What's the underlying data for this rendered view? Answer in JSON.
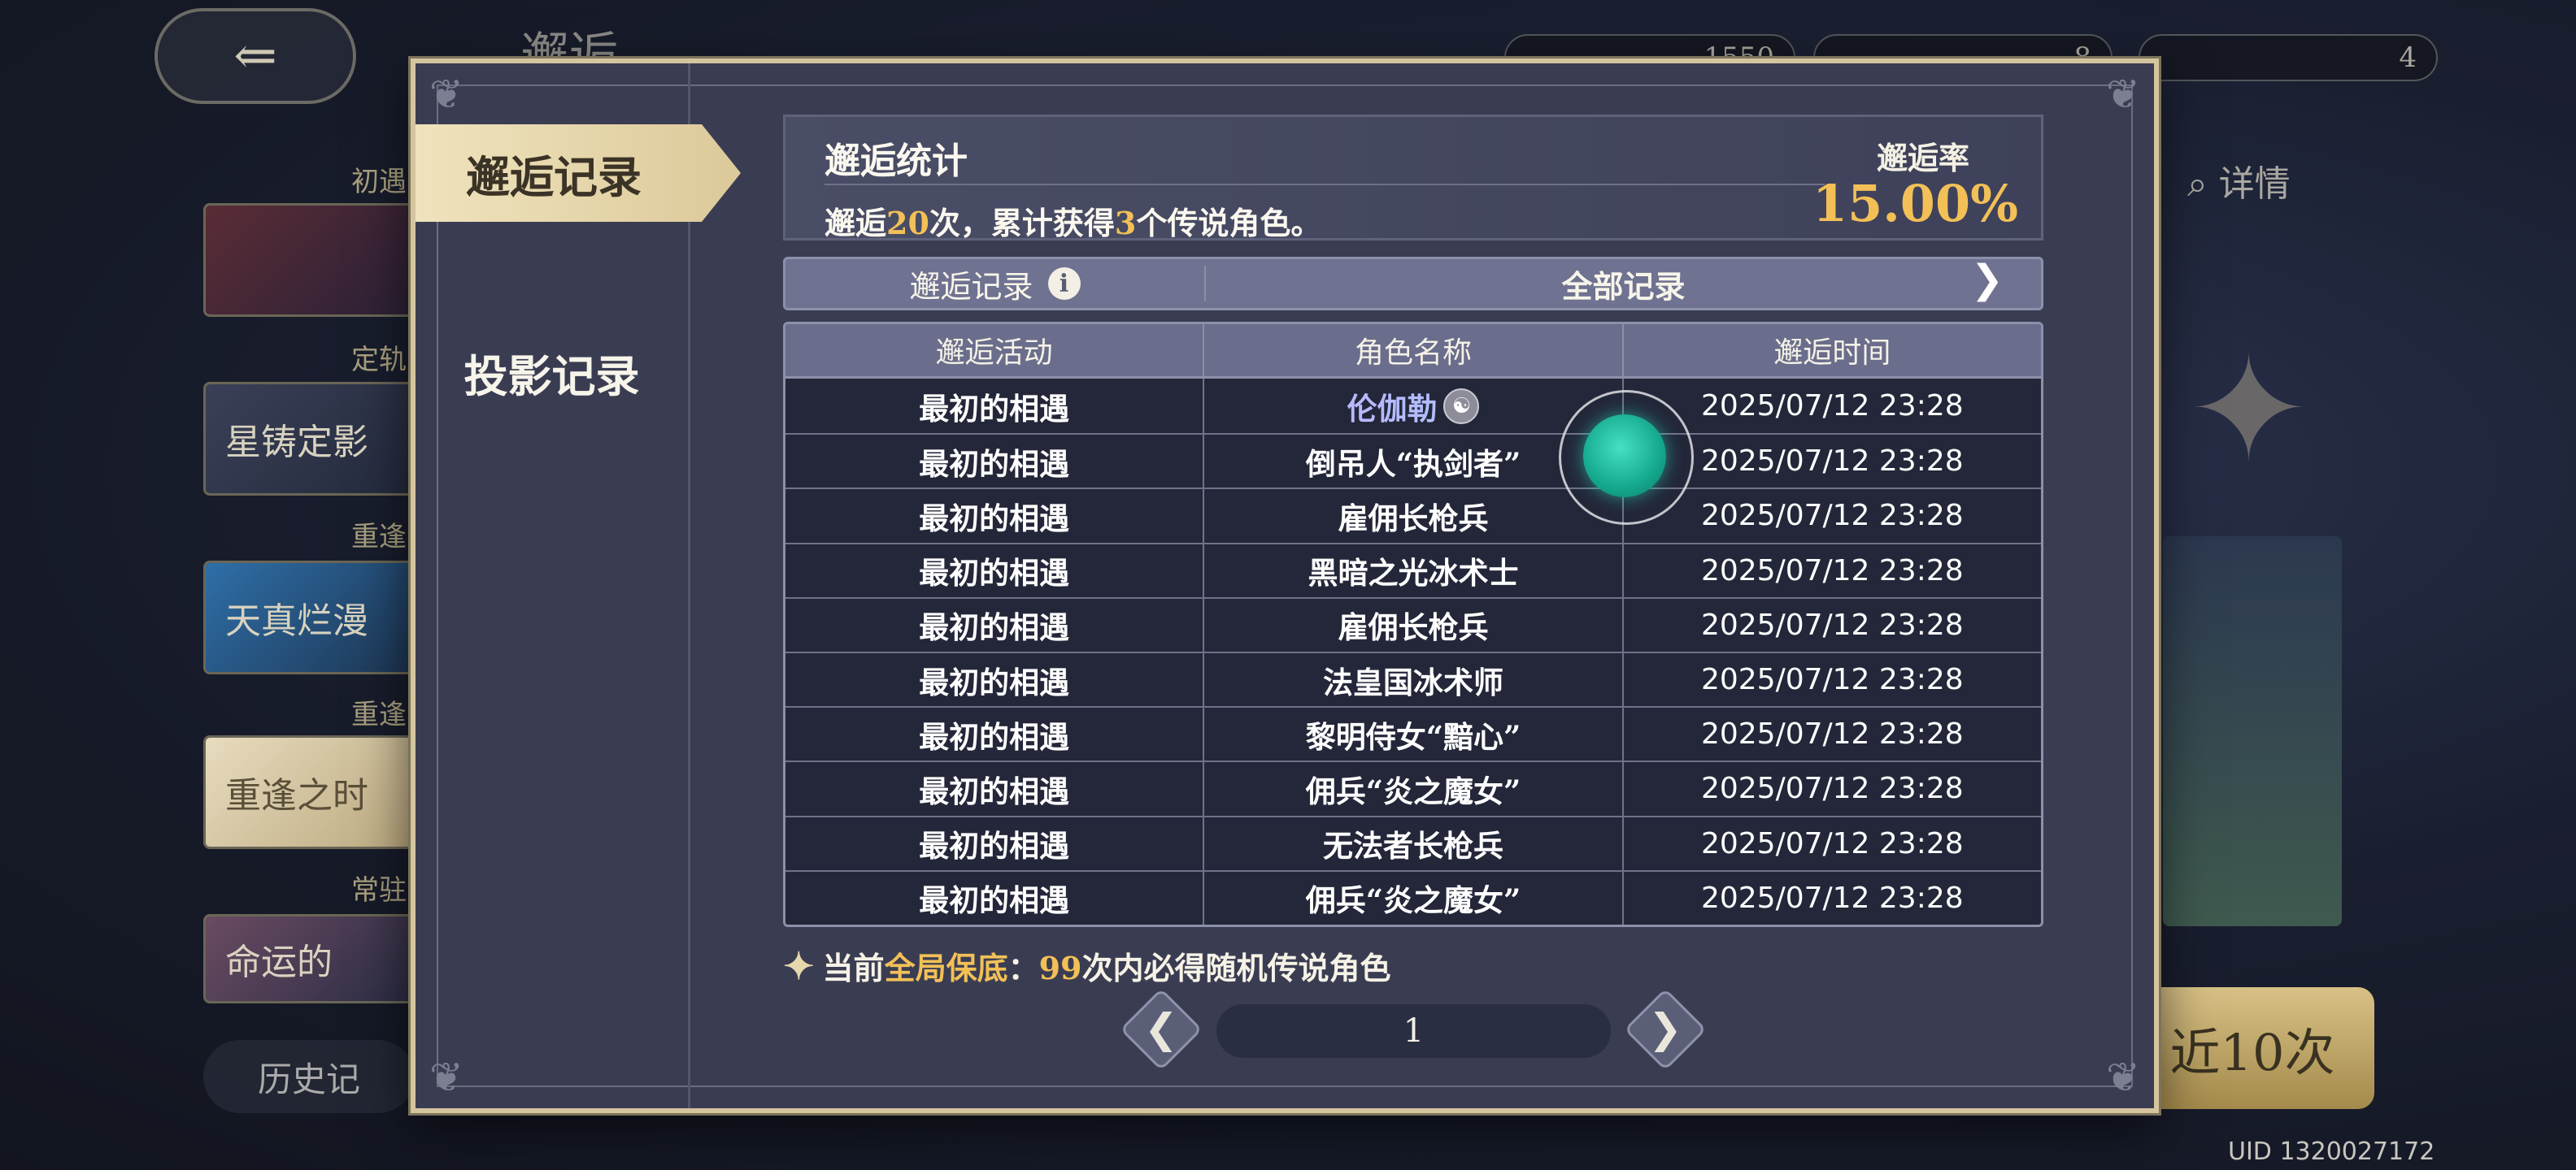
{
  "background": {
    "title": "邂逅",
    "currencies": [
      "1550",
      "8",
      "4"
    ],
    "side_tags": [
      "初遇",
      "定轨",
      "重逢",
      "重逢",
      "常驻"
    ],
    "side_cards": [
      "",
      "星铸定影",
      "天真烂漫",
      "重逢之时",
      "命运的"
    ],
    "history_button": "历史记",
    "details_label": "详情",
    "summon_button": "近10次",
    "uid": "UID 1320027172"
  },
  "modal": {
    "tabs": [
      {
        "label": "邂逅记录",
        "active": true
      },
      {
        "label": "投影记录",
        "active": false
      }
    ],
    "stats": {
      "title": "邂逅统计",
      "desc_prefix": "邂逅",
      "count": "20",
      "desc_mid": "次，累计获得",
      "legend_count": "3",
      "desc_suffix": "个传说角色。",
      "rate_label": "邂逅率",
      "rate_value": "15.00%"
    },
    "filter": {
      "left_label": "邂逅记录",
      "right_label": "全部记录"
    },
    "table": {
      "headers": [
        "邂逅活动",
        "角色名称",
        "邂逅时间"
      ],
      "rows": [
        {
          "activity": "最初的相遇",
          "name": "伦伽勒",
          "time": "2025/07/12 23:28",
          "legendary": true
        },
        {
          "activity": "最初的相遇",
          "name": "倒吊人“执剑者”",
          "time": "2025/07/12 23:28",
          "legendary": false
        },
        {
          "activity": "最初的相遇",
          "name": "雇佣长枪兵",
          "time": "2025/07/12 23:28",
          "legendary": false
        },
        {
          "activity": "最初的相遇",
          "name": "黑暗之光冰术士",
          "time": "2025/07/12 23:28",
          "legendary": false
        },
        {
          "activity": "最初的相遇",
          "name": "雇佣长枪兵",
          "time": "2025/07/12 23:28",
          "legendary": false
        },
        {
          "activity": "最初的相遇",
          "name": "法皇国冰术师",
          "time": "2025/07/12 23:28",
          "legendary": false
        },
        {
          "activity": "最初的相遇",
          "name": "黎明侍女“黯心”",
          "time": "2025/07/12 23:28",
          "legendary": false
        },
        {
          "activity": "最初的相遇",
          "name": "佣兵“炎之魔女”",
          "time": "2025/07/12 23:28",
          "legendary": false
        },
        {
          "activity": "最初的相遇",
          "name": "无法者长枪兵",
          "time": "2025/07/12 23:28",
          "legendary": false
        },
        {
          "activity": "最初的相遇",
          "name": "佣兵“炎之魔女”",
          "time": "2025/07/12 23:28",
          "legendary": false
        }
      ]
    },
    "pity": {
      "prefix": "当前",
      "highlight": "全局保底",
      "colon": "：",
      "count": "99",
      "suffix": "次内必得随机传说角色"
    },
    "pagination": {
      "page": "1"
    }
  },
  "colors": {
    "accent_gold": "#f2c057",
    "legend_purple": "#c8b0ff",
    "tap_indicator": "#14a88e"
  }
}
